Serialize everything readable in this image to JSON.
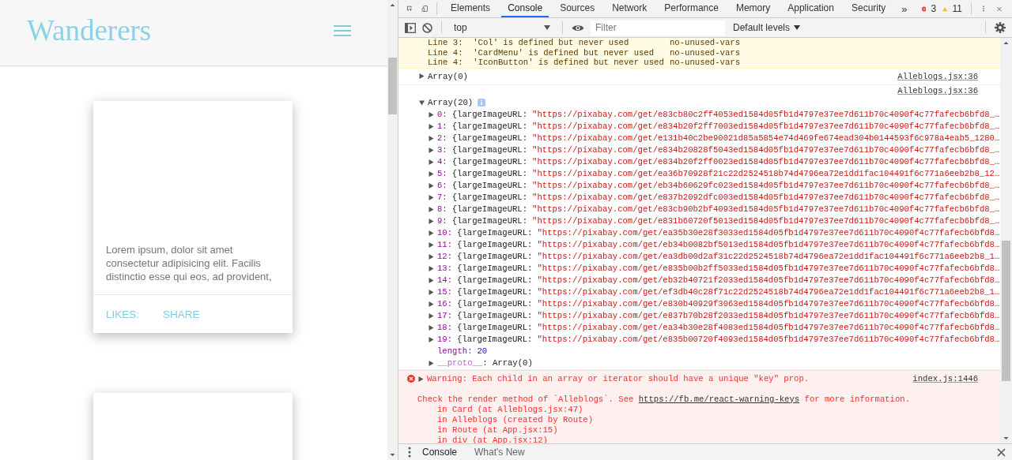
{
  "page": {
    "logo": "Wanderers",
    "cards": [
      {
        "kind": "text",
        "text": "Lorem ipsum, dolor sit amet consectetur adipisicing elit. Facilis distinctio esse qui eos, ad provident,",
        "actions": [
          "LIKES:",
          "SHARE"
        ]
      },
      {
        "kind": "blank"
      }
    ]
  },
  "devtools": {
    "tabs": [
      {
        "label": "Elements",
        "selected": false
      },
      {
        "label": "Console",
        "selected": true
      },
      {
        "label": "Sources",
        "selected": false
      },
      {
        "label": "Network",
        "selected": false
      },
      {
        "label": "Performance",
        "selected": false
      },
      {
        "label": "Memory",
        "selected": false
      },
      {
        "label": "Application",
        "selected": false
      },
      {
        "label": "Security",
        "selected": false
      }
    ],
    "overflow": "»",
    "errors": "3",
    "warnings": "11",
    "toolbar": {
      "context": "top",
      "filter": {
        "placeholder": "Filter"
      },
      "levels": "Default levels"
    },
    "messages": [
      {
        "kind": "lint",
        "lines": [
          {
            "text": "Line 3:  'Col' is defined but never used",
            "rule": "no-unused-vars"
          },
          {
            "text": "Line 4:  'CardMenu' is defined but never used",
            "rule": "no-unused-vars"
          },
          {
            "text": "Line 4:  'IconButton' is defined but never used",
            "rule": "no-unused-vars"
          }
        ]
      },
      {
        "kind": "log",
        "label": "Array(0)",
        "expanded": false,
        "source": "Alleblogs.jsx:36"
      },
      {
        "kind": "object",
        "label": "Array(20)",
        "expanded": true,
        "source": "Alleblogs.jsx:36",
        "items": [
          {
            "index": "0:",
            "key": "{largeImageURL:",
            "value": "\"https://pixabay.com/get/e83cb80c2ff4053ed1584d05fb1d4797e37ee7d611b70c4090f4c77fafecb6bfd8_…"
          },
          {
            "index": "1:",
            "key": "{largeImageURL:",
            "value": "\"https://pixabay.com/get/e834b20f2ff7003ed1584d05fb1d4797e37ee7d611b70c4090f4c77fafecb6bfd8_…"
          },
          {
            "index": "2:",
            "key": "{largeImageURL:",
            "value": "\"https://pixabay.com/get/e131b40c2be90021d85a5854e74d469fe674ead304b0144593f6c978a4eab5_1280…"
          },
          {
            "index": "3:",
            "key": "{largeImageURL:",
            "value": "\"https://pixabay.com/get/e834b20828f5043ed1584d05fb1d4797e37ee7d611b70c4090f4c77fafecb6bfd8_…"
          },
          {
            "index": "4:",
            "key": "{largeImageURL:",
            "value": "\"https://pixabay.com/get/e834b20f2ff0023ed1584d05fb1d4797e37ee7d611b70c4090f4c77fafecb6bfd8_…"
          },
          {
            "index": "5:",
            "key": "{largeImageURL:",
            "value": "\"https://pixabay.com/get/ea36b70928f21c22d2524518b74d4796ea72e1dd1fac104491f6c771a6eeb2b8_12…"
          },
          {
            "index": "6:",
            "key": "{largeImageURL:",
            "value": "\"https://pixabay.com/get/eb34b60629fc023ed1584d05fb1d4797e37ee7d611b70c4090f4c77fafecb6bfd8_…"
          },
          {
            "index": "7:",
            "key": "{largeImageURL:",
            "value": "\"https://pixabay.com/get/e837b2092dfc003ed1584d05fb1d4797e37ee7d611b70c4090f4c77fafecb6bfd8_…"
          },
          {
            "index": "8:",
            "key": "{largeImageURL:",
            "value": "\"https://pixabay.com/get/e83cb90b2bf4093ed1584d05fb1d4797e37ee7d611b70c4090f4c77fafecb6bfd8_…"
          },
          {
            "index": "9:",
            "key": "{largeImageURL:",
            "value": "\"https://pixabay.com/get/e831b60720f5013ed1584d05fb1d4797e37ee7d611b70c4090f4c77fafecb6bfd8_…"
          },
          {
            "index": "10:",
            "key": "{largeImageURL:",
            "value": "\"https://pixabay.com/get/ea35b30e28f3033ed1584d05fb1d4797e37ee7d611b70c4090f4c77fafecb6bfd8…"
          },
          {
            "index": "11:",
            "key": "{largeImageURL:",
            "value": "\"https://pixabay.com/get/eb34b0082bf5013ed1584d05fb1d4797e37ee7d611b70c4090f4c77fafecb6bfd8…"
          },
          {
            "index": "12:",
            "key": "{largeImageURL:",
            "value": "\"https://pixabay.com/get/ea3db00d2af31c22d2524518b74d4796ea72e1dd1fac104491f6c771a6eeb2b8_1…"
          },
          {
            "index": "13:",
            "key": "{largeImageURL:",
            "value": "\"https://pixabay.com/get/e835b00b2ff5033ed1584d05fb1d4797e37ee7d611b70c4090f4c77fafecb6bfd8…"
          },
          {
            "index": "14:",
            "key": "{largeImageURL:",
            "value": "\"https://pixabay.com/get/eb32b40721f2033ed1584d05fb1d4797e37ee7d611b70c4090f4c77fafecb6bfd8…"
          },
          {
            "index": "15:",
            "key": "{largeImageURL:",
            "value": "\"https://pixabay.com/get/ef3db40c28f71c22d2524518b74d4796ea72e1dd1fac104491f6c771a6eeb2b8_1…"
          },
          {
            "index": "16:",
            "key": "{largeImageURL:",
            "value": "\"https://pixabay.com/get/e830b40929f3063ed1584d05fb1d4797e37ee7d611b70c4090f4c77fafecb6bfd8…"
          },
          {
            "index": "17:",
            "key": "{largeImageURL:",
            "value": "\"https://pixabay.com/get/e837b70b28f2033ed1584d05fb1d4797e37ee7d611b70c4090f4c77fafecb6bfd8…"
          },
          {
            "index": "18:",
            "key": "{largeImageURL:",
            "value": "\"https://pixabay.com/get/ea34b30e28f4083ed1584d05fb1d4797e37ee7d611b70c4090f4c77fafecb6bfd8…"
          },
          {
            "index": "19:",
            "key": "{largeImageURL:",
            "value": "\"https://pixabay.com/get/e835b00720f4093ed1584d05fb1d4797e37ee7d611b70c4090f4c77fafecb6bfd8…"
          }
        ],
        "length": {
          "key": "length:",
          "value": "20"
        },
        "proto": {
          "key": "__proto__",
          "value": ": Array(0)",
          "expanded": false
        }
      },
      {
        "kind": "error",
        "expanded": false,
        "text": "Warning: Each child in an array or iterator should have a unique \"key\" prop.",
        "source": "index.js:1446",
        "details": "Check the render method of `Alleblogs`. See",
        "link": "https://fb.me/react-warning-keys",
        "suffix": "for more information.",
        "stack": [
          "in Card (at Alleblogs.jsx:47)",
          "in Alleblogs (created by Route)",
          "in Route (at App.jsx:15)",
          "in div (at App.jsx:12)"
        ]
      }
    ],
    "drawer_tabs": [
      {
        "label": "Console",
        "selected": true
      },
      {
        "label": "What's New",
        "selected": false
      }
    ]
  }
}
